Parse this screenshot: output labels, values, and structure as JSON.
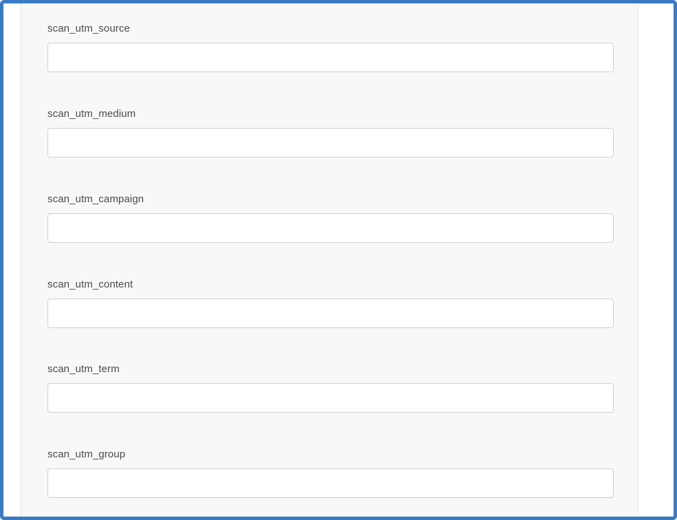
{
  "form": {
    "fields": [
      {
        "label": "scan_utm_source",
        "value": ""
      },
      {
        "label": "scan_utm_medium",
        "value": ""
      },
      {
        "label": "scan_utm_campaign",
        "value": ""
      },
      {
        "label": "scan_utm_content",
        "value": ""
      },
      {
        "label": "scan_utm_term",
        "value": ""
      },
      {
        "label": "scan_utm_group",
        "value": ""
      }
    ]
  },
  "colors": {
    "frame_border": "#3a7bc4",
    "panel_background": "#f8f8f8",
    "input_border": "#cfcfcf",
    "label_text": "#4a4a4a"
  }
}
